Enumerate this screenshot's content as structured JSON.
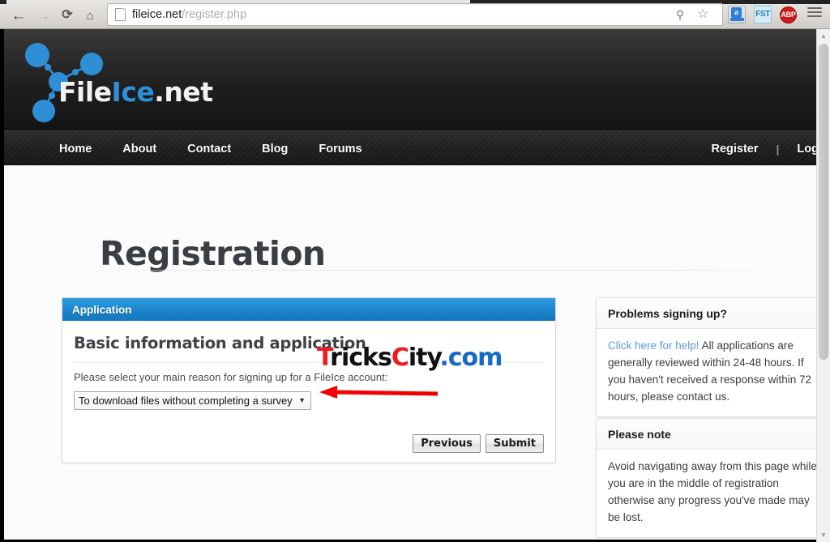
{
  "browser": {
    "back_icon": "back-arrow-icon",
    "forward_icon": "forward-arrow-icon",
    "reload_label": "⟳",
    "home_label": "⌂",
    "url_host": "fileice.net",
    "url_path": "/register.php",
    "url_full": "fileice.net/register.php",
    "key_icon": "key-icon",
    "star_icon": "star-icon",
    "extensions": [
      {
        "name": "amazon-assistant-icon",
        "label": "a"
      },
      {
        "name": "fst-extension-icon",
        "label": "FST"
      },
      {
        "name": "adblock-plus-icon",
        "label": "ABP"
      }
    ],
    "menu_label": "chrome-menu-icon"
  },
  "site": {
    "logo": {
      "text_white_1": "File",
      "text_blue": "Ice",
      "text_white_2": ".net",
      "accent": "#2f8fd6"
    },
    "nav_left": [
      "Home",
      "About",
      "Contact",
      "Blog",
      "Forums"
    ],
    "nav_right": {
      "register": "Register",
      "separator": "|",
      "login": "Log"
    }
  },
  "page": {
    "title": "Registration"
  },
  "application_panel": {
    "header": "Application",
    "subtitle": "Basic information and application",
    "instruction": "Please select your main reason for signing up for a FileIce account:",
    "select": {
      "selected": "To download files without completing a survey",
      "options": [
        "To download files without completing a survey"
      ],
      "caret": "▼"
    },
    "buttons": {
      "previous": "Previous",
      "submit": "Submit"
    }
  },
  "annotation": {
    "arrow_color": "#f40000",
    "arrow_direction": "left",
    "points_at": "reason-select"
  },
  "watermark": {
    "part_1": "T",
    "part_2": "ricks",
    "part_3": "C",
    "part_4": "ity",
    "part_5": ".com",
    "full": "TricksCity.com",
    "color_red": "#ee1c1c",
    "color_black": "#111111",
    "color_blue": "#1569c7"
  },
  "sidebar": {
    "help_panel": {
      "title": "Problems signing up?",
      "link_text": "Click here for help!",
      "body": " All applications are generally reviewed within 24-48 hours. If you haven't received a response within 72 hours, please contact us.",
      "link_color": "#5b9bd5"
    },
    "note_panel": {
      "title": "Please note",
      "body": "Avoid navigating away from this page while you are in the middle of registration otherwise any progress you've made may be lost."
    }
  },
  "scrollbar": {
    "up": "▲",
    "down": "▼"
  }
}
